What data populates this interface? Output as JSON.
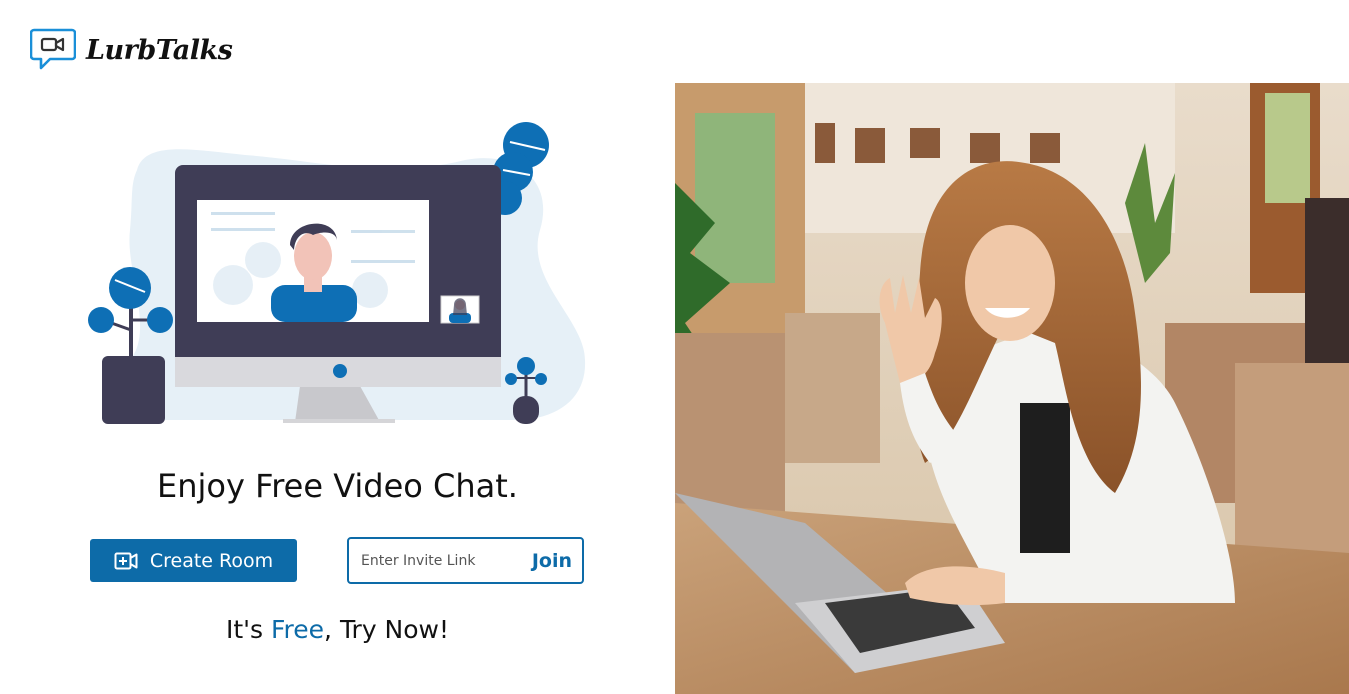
{
  "brand": {
    "name": "LurbTalks"
  },
  "headline": "Enjoy Free Video Chat.",
  "actions": {
    "create_room_label": "Create Room",
    "invite_placeholder": "Enter Invite Link",
    "join_label": "Join"
  },
  "tagline": {
    "prefix": "It's ",
    "highlight": "Free",
    "suffix": ", Try Now!"
  },
  "icons": {
    "logo": "video-chat-bubble-icon",
    "create_room": "video-plus-icon"
  },
  "colors": {
    "primary": "#0d6ba8",
    "accent_blue": "#0e6fb5",
    "monitor_dark": "#3f3d56",
    "blob_light": "#e6f0f7"
  }
}
